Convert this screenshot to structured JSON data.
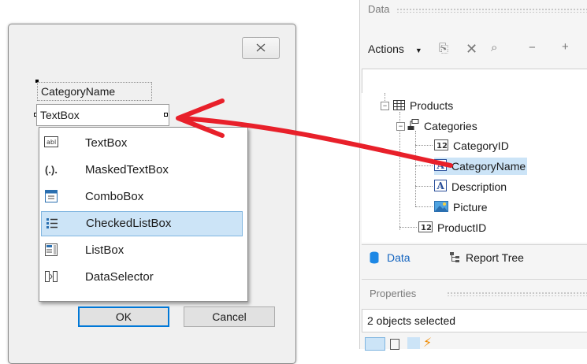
{
  "dialog": {
    "field_label": "CategoryName",
    "field_textbox": "TextBox",
    "popup_items": [
      {
        "icon": "abl",
        "label": "TextBox"
      },
      {
        "icon": "(.).",
        "label": "MaskedTextBox"
      },
      {
        "icon": "combo",
        "label": "ComboBox"
      },
      {
        "icon": "checklist",
        "label": "CheckedListBox"
      },
      {
        "icon": "list",
        "label": "ListBox"
      },
      {
        "icon": "selector",
        "label": "DataSelector"
      }
    ],
    "selected_popup_index": 3,
    "ok_label": "OK",
    "cancel_label": "Cancel"
  },
  "data_panel": {
    "title": "Data",
    "actions_label": "Actions",
    "tree": [
      {
        "label": "Products",
        "icon": "table"
      },
      {
        "label": "Categories",
        "icon": "relation"
      },
      {
        "label": "CategoryID",
        "icon": "number"
      },
      {
        "label": "CategoryName",
        "icon": "text"
      },
      {
        "label": "Description",
        "icon": "text"
      },
      {
        "label": "Picture",
        "icon": "picture"
      },
      {
        "label": "ProductID",
        "icon": "number"
      }
    ],
    "selected_tree_item": "CategoryName",
    "tabs": [
      {
        "label": "Data",
        "active": true
      },
      {
        "label": "Report Tree",
        "active": false
      }
    ]
  },
  "properties_panel": {
    "title": "Properties",
    "selection_text": "2 objects selected"
  },
  "colors": {
    "arrow": "#e8202a",
    "selection": "#cce4f7",
    "accent": "#1565c0"
  }
}
